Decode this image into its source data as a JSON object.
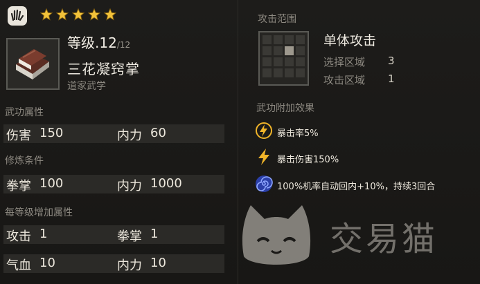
{
  "header": {
    "stars": 5,
    "star_color": "#f2c23a"
  },
  "item": {
    "level_label": "等级.12",
    "level_max": "/12",
    "name": "三花凝窍掌",
    "school": "道家武学"
  },
  "sections": {
    "attributes_title": "武功属性",
    "requirements_title": "修炼条件",
    "per_level_title": "每等级增加属性"
  },
  "attributes": [
    {
      "label": "伤害",
      "value": "150"
    },
    {
      "label": "内力",
      "value": "60"
    }
  ],
  "requirements": [
    {
      "label": "拳掌",
      "value": "100"
    },
    {
      "label": "内力",
      "value": "1000"
    }
  ],
  "per_level": [
    {
      "label": "攻击",
      "value": "1"
    },
    {
      "label": "拳掌",
      "value": "1"
    },
    {
      "label": "气血",
      "value": "10"
    },
    {
      "label": "内力",
      "value": "10"
    }
  ],
  "attack_range": {
    "title": "攻击范围",
    "name": "单体攻击",
    "select_label": "选择区域",
    "select_value": "3",
    "attack_label": "攻击区域",
    "attack_value": "1"
  },
  "effects": {
    "title": "武功附加效果",
    "items": [
      {
        "icon": "lightning-circle-icon",
        "text": "暴击率5%"
      },
      {
        "icon": "lightning-icon",
        "text": "暴击伤害150%"
      },
      {
        "icon": "spiral-icon",
        "text": "100%机率自动回内+10%，持续3回合"
      }
    ]
  },
  "watermark": {
    "text": "交易猫"
  }
}
